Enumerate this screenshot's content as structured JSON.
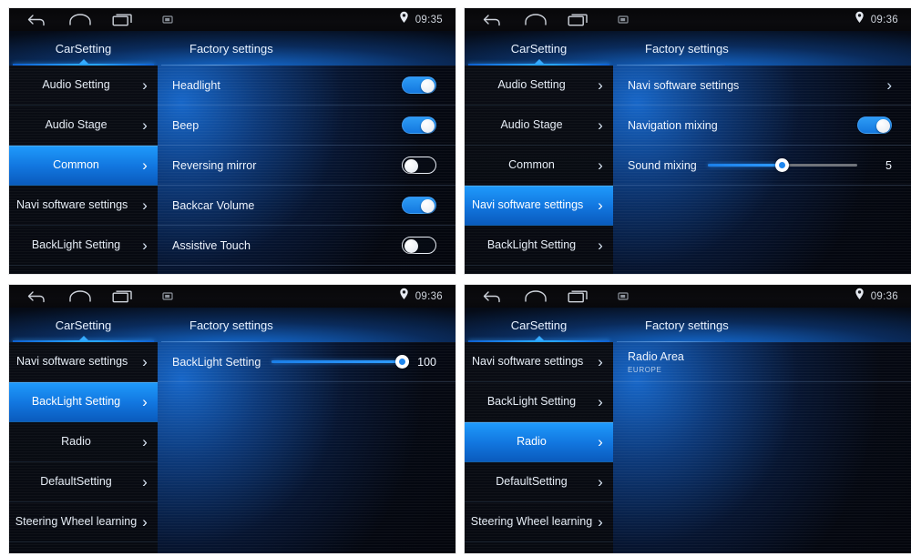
{
  "colors": {
    "accent": "#1e86ef",
    "accent_bright": "#2f9dff",
    "panel_bg": "#05070d",
    "text": "#eef4fd"
  },
  "icons": {
    "back": "back-icon",
    "home": "home-icon",
    "recents": "recents-icon",
    "screenshot": "screenshot-icon",
    "location": "location-pin-icon",
    "chevron": "chevron-right-icon"
  },
  "panels": [
    {
      "id": "panel-1",
      "status": {
        "time": "09:35"
      },
      "tabs": [
        {
          "label": "CarSetting",
          "selected": true
        },
        {
          "label": "Factory settings",
          "selected": false
        }
      ],
      "sidebar": [
        {
          "label": "Audio Setting",
          "selected": false,
          "wide": false
        },
        {
          "label": "Audio Stage",
          "selected": false,
          "wide": false
        },
        {
          "label": "Common",
          "selected": true,
          "wide": false
        },
        {
          "label": "Navi software settings",
          "selected": false,
          "wide": true
        },
        {
          "label": "BackLight Setting",
          "selected": false,
          "wide": false
        }
      ],
      "rows": [
        {
          "type": "toggle",
          "label": "Headlight",
          "value": "on"
        },
        {
          "type": "toggle",
          "label": "Beep",
          "value": "on"
        },
        {
          "type": "toggle",
          "label": "Reversing mirror",
          "value": "off"
        },
        {
          "type": "toggle",
          "label": "Backcar Volume",
          "value": "on"
        },
        {
          "type": "toggle",
          "label": "Assistive Touch",
          "value": "off"
        }
      ]
    },
    {
      "id": "panel-2",
      "status": {
        "time": "09:36"
      },
      "tabs": [
        {
          "label": "CarSetting",
          "selected": true
        },
        {
          "label": "Factory settings",
          "selected": false
        }
      ],
      "sidebar": [
        {
          "label": "Audio Setting",
          "selected": false,
          "wide": false
        },
        {
          "label": "Audio Stage",
          "selected": false,
          "wide": false
        },
        {
          "label": "Common",
          "selected": false,
          "wide": false
        },
        {
          "label": "Navi software settings",
          "selected": true,
          "wide": true
        },
        {
          "label": "BackLight Setting",
          "selected": false,
          "wide": false
        }
      ],
      "rows": [
        {
          "type": "link",
          "label": "Navi software settings"
        },
        {
          "type": "toggle",
          "label": "Navigation mixing",
          "value": "on"
        },
        {
          "type": "slider",
          "label": "Sound mixing",
          "value": "5",
          "percent": 50
        }
      ]
    },
    {
      "id": "panel-3",
      "status": {
        "time": "09:36"
      },
      "tabs": [
        {
          "label": "CarSetting",
          "selected": true
        },
        {
          "label": "Factory settings",
          "selected": false
        }
      ],
      "sidebar": [
        {
          "label": "Navi software settings",
          "selected": false,
          "wide": true
        },
        {
          "label": "BackLight Setting",
          "selected": true,
          "wide": false
        },
        {
          "label": "Radio",
          "selected": false,
          "wide": false
        },
        {
          "label": "DefaultSetting",
          "selected": false,
          "wide": false
        },
        {
          "label": "Steering Wheel learning",
          "selected": false,
          "wide": false
        }
      ],
      "rows": [
        {
          "type": "slider",
          "label": "BackLight Setting",
          "value": "100",
          "percent": 100
        }
      ]
    },
    {
      "id": "panel-4",
      "status": {
        "time": "09:36"
      },
      "tabs": [
        {
          "label": "CarSetting",
          "selected": true
        },
        {
          "label": "Factory settings",
          "selected": false
        }
      ],
      "sidebar": [
        {
          "label": "Navi software settings",
          "selected": false,
          "wide": true
        },
        {
          "label": "BackLight Setting",
          "selected": false,
          "wide": false
        },
        {
          "label": "Radio",
          "selected": true,
          "wide": false
        },
        {
          "label": "DefaultSetting",
          "selected": false,
          "wide": false
        },
        {
          "label": "Steering Wheel learning",
          "selected": false,
          "wide": false
        }
      ],
      "rows": [
        {
          "type": "sub",
          "label": "Radio Area",
          "sub": "EUROPE"
        }
      ]
    }
  ]
}
